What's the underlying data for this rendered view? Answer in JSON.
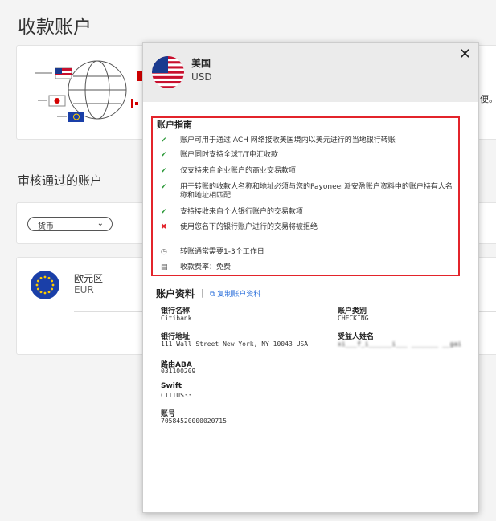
{
  "page": {
    "title": "收款账户",
    "intro_text_fragment": "便。"
  },
  "accounts_section": {
    "title": "审核通过的账户",
    "currency_filter": "货币"
  },
  "eu_account": {
    "name": "欧元区",
    "code": "EUR"
  },
  "modal": {
    "country": "美国",
    "currency": "USD",
    "close_icon": "close-icon",
    "guide": {
      "title": "账户指南",
      "items": [
        {
          "type": "ok",
          "text": "账户可用于通过 ACH 网络接收美国境内以美元进行的当地银行转账"
        },
        {
          "type": "ok",
          "text": "账户同时支持全球T/T电汇收款"
        },
        {
          "type": "ok",
          "text": "仅支持来自企业账户的商业交易款项"
        },
        {
          "type": "ok",
          "text": "用于转账的收款人名称和地址必须与您的Payoneer派安盈账户资料中的账户持有人名称和地址相匹配"
        },
        {
          "type": "ok",
          "text": "支持接收来自个人银行账户的交易款项"
        },
        {
          "type": "bad",
          "text": "使用您名下的银行账户进行的交易将被拒绝"
        },
        {
          "type": "info",
          "icon": "clock-icon",
          "text": "转账通常需要1-3个工作日"
        },
        {
          "type": "info",
          "icon": "receipt-icon",
          "text": "收款费率：免费"
        }
      ]
    },
    "profile": {
      "title": "账户资料",
      "copy_label": "复制账户资料",
      "bank_name_label": "银行名称",
      "bank_name_value": "Citibank",
      "account_type_label": "账户类别",
      "account_type_value": "CHECKING",
      "bank_address_label": "银行地址",
      "bank_address_value": "111 Wall Street New York, NY 10043 USA",
      "beneficiary_label": "受益人姓名",
      "beneficiary_value": "xi___f_i______i___ _______ __gai",
      "aba_label": "路由ABA",
      "aba_value": "031100209",
      "swift_label": "Swift",
      "swift_value": "CITIUS33",
      "account_no_label": "账号",
      "account_no_value": "70584520000020715"
    }
  },
  "colors": {
    "accent_red": "#e3242b",
    "check_green": "#2e9a3b",
    "link_blue": "#2a6fdb",
    "header_gray": "#ebebeb"
  }
}
